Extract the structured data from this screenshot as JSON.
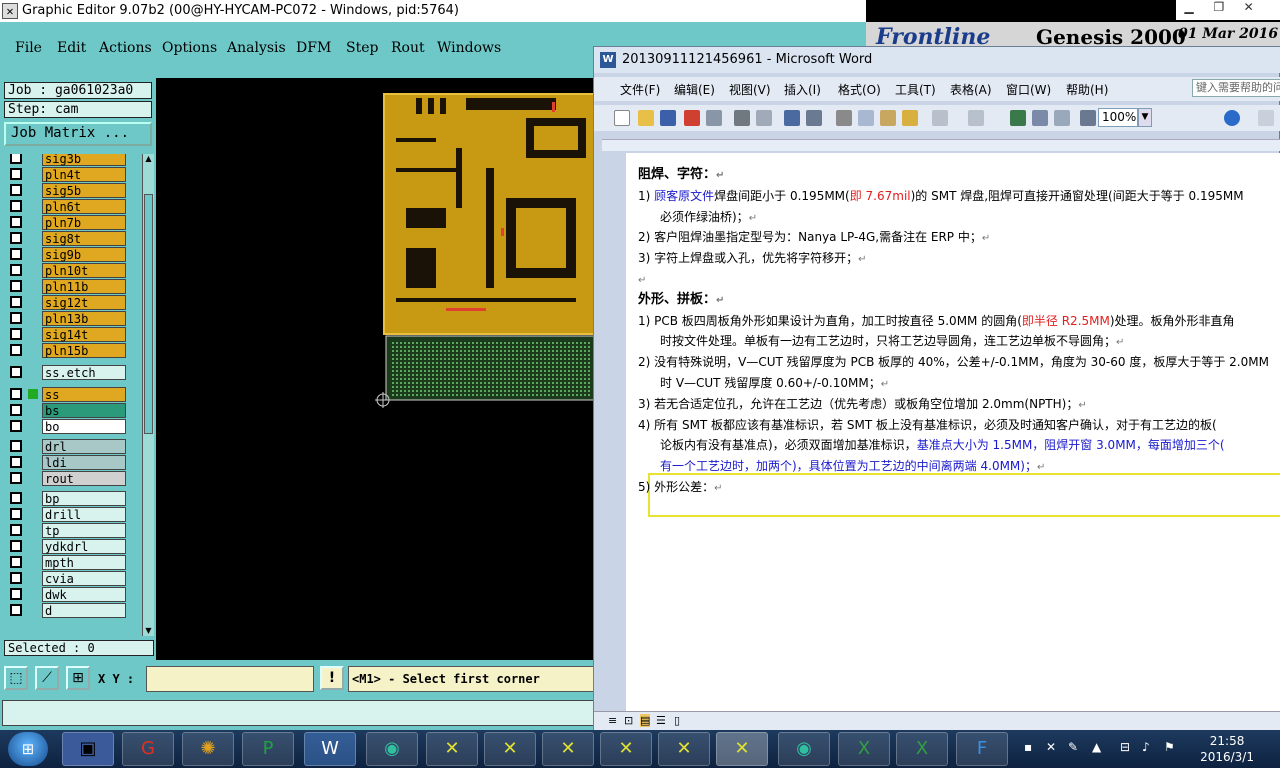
{
  "genesis_window": {
    "title": "Graphic Editor 9.07b2 (00@HY-HYCAM-PC072 - Windows, pid:5764)",
    "menu": [
      "File",
      "Edit",
      "Actions",
      "Options",
      "Analysis",
      "DFM",
      "Step",
      "Rout",
      "Windows"
    ],
    "job": "Job : ga061023a0",
    "step": "Step: cam",
    "job_matrix": "Job Matrix ...",
    "layers": [
      {
        "name": "sig3b",
        "color": "#e0a820"
      },
      {
        "name": "pln4t",
        "color": "#e0a820"
      },
      {
        "name": "sig5b",
        "color": "#e0a820"
      },
      {
        "name": "pln6t",
        "color": "#e0a820"
      },
      {
        "name": "pln7b",
        "color": "#e0a820"
      },
      {
        "name": "sig8t",
        "color": "#e0a820"
      },
      {
        "name": "sig9b",
        "color": "#e0a820"
      },
      {
        "name": "pln10t",
        "color": "#e0a820"
      },
      {
        "name": "pln11b",
        "color": "#e0a820"
      },
      {
        "name": "sig12t",
        "color": "#e0a820"
      },
      {
        "name": "pln13b",
        "color": "#e0a820"
      },
      {
        "name": "sig14t",
        "color": "#e0a820"
      },
      {
        "name": "pln15b",
        "color": "#e0a820"
      },
      {
        "name": "ss.etch",
        "color": "#d8f2ee"
      },
      {
        "name": "ss",
        "color": "#e0a820"
      },
      {
        "name": "bs",
        "color": "#2a9a7a"
      },
      {
        "name": "bo",
        "color": "#ffffff"
      },
      {
        "name": "drl",
        "color": "#a8c8c8"
      },
      {
        "name": "ldi",
        "color": "#a8c8c8"
      },
      {
        "name": "rout",
        "color": "#d0d0d0"
      },
      {
        "name": "bp",
        "color": "#d8f2ee"
      },
      {
        "name": "drill",
        "color": "#d8f2ee"
      },
      {
        "name": "tp",
        "color": "#d8f2ee"
      },
      {
        "name": "ydkdrl",
        "color": "#d8f2ee"
      },
      {
        "name": "mpth",
        "color": "#d8f2ee"
      },
      {
        "name": "cvia",
        "color": "#d8f2ee"
      },
      {
        "name": "dwk",
        "color": "#d8f2ee"
      },
      {
        "name": "d",
        "color": "#d8f2ee"
      }
    ],
    "selected": "Selected : 0",
    "xy_label": "X Y :",
    "xy_value": "",
    "prompt": "<M1> - Select first corner"
  },
  "genesis_banner": {
    "logo": "Frontline",
    "product": "Genesis 2000",
    "date": "01 Mar 2016"
  },
  "word_window": {
    "title": "20130911121456961 - Microsoft Word",
    "menu": [
      "文件(F)",
      "编辑(E)",
      "视图(V)",
      "插入(I)",
      "格式(O)",
      "工具(T)",
      "表格(A)",
      "窗口(W)",
      "帮助(H)"
    ],
    "ask_box": "键入需要帮助的问题",
    "zoom": "100%",
    "paragraph_mark": "↵",
    "doc": {
      "h1": "阻焊、字符：",
      "p1a": "1) ",
      "p1b": "顾客原文件",
      "p1c": "焊盘间距小于 0.195MM(",
      "p1d": "即 7.67mil",
      "p1e": ")的 SMT 焊盘,阻焊可直接开通窗处理(间距大于等于 0.195MM",
      "p1f": "必须作绿油桥)；",
      "p2": "2) 客户阻焊油墨指定型号为：Nanya LP-4G,需备注在 ERP 中；",
      "p3": "3) 字符上焊盘或入孔，优先将字符移开；",
      "h2": "外形、拼板：",
      "p4a": "1) PCB 板四周板角外形如果设计为直角，加工时按直径 5.0MM 的圆角(",
      "p4b": "即半径 R2.5MM",
      "p4c": ")处理。板角外形非直角",
      "p4d": "时按文件处理。单板有一边有工艺边时，只将工艺边导圆角，连工艺边单板不导圆角；",
      "p5a": "2) 没有特殊说明，V—CUT 残留厚度为 PCB 板厚的 40%，公差+/-0.1MM，角度为 30-60 度，板厚大于等于 2.0MM",
      "p5b": "时 V—CUT 残留厚度 0.60+/-0.10MM；",
      "p6": "3) 若无合适定位孔，允许在工艺边（优先考虑）或板角空位增加 2.0mm(NPTH)；",
      "p7a": "4) 所有 SMT 板都应该有基准标识，若 SMT 板上没有基准标识，必须及时通知客户确认，对于有工艺边的板(",
      "p7b": "论板内有没有基准点)，必须双面增加基准标识，",
      "p7c": "基准点大小为 1.5MM，阻焊开窗 3.0MM，每面增加三个(",
      "p7d": "有一个工艺边时，加两个)，具体位置为工艺边的中间离两端 4.0MM)；",
      "p8": "5) 外形公差："
    }
  },
  "taskbar": {
    "time": "21:58",
    "date": "2016/3/1"
  }
}
